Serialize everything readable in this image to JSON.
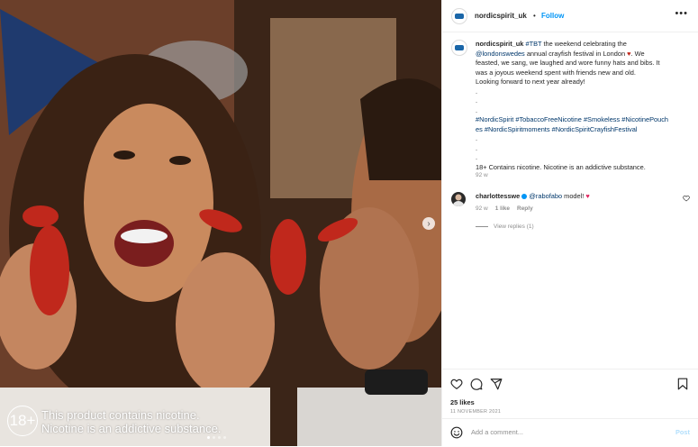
{
  "photo": {
    "overlay_line1": "This product contains nicotine.",
    "overlay_line2": "Nicotine is an addictive substance.",
    "age_badge": "18+",
    "next_icon": "chevron-right-icon",
    "carousel_count": 4,
    "carousel_active": 1
  },
  "header": {
    "username": "nordicspirit_uk",
    "separator": "•",
    "follow_label": "Follow",
    "more_icon": "more-horizontal-icon"
  },
  "caption": {
    "username": "nordicspirit_uk",
    "tbt": "#TBT",
    "line1_after": " the weekend celebrating the",
    "mention": "@londonswedes",
    "line2_after": " annual crayfish festival in London",
    "line3": "feasted, we sang, we laughed and wore funny hats and bibs. It",
    "line4": "was a joyous weekend spent with friends new and old.",
    "line5": "Looking forward to next year already!",
    "line3_prefix": ". We",
    "dot": ".",
    "hashtags_line1": "#NordicSpirit #TobaccoFreeNicotine #Smokeless #NicotinePouch",
    "hashtags_line2": "es #NordicSpiritmoments #NordicSpiritCrayfishFestival",
    "warning": "18+ Contains nicotine. Nicotine is an addictive substance.",
    "time": "92 w"
  },
  "comment": {
    "username": "charlottesswe",
    "mention": "@rabofabo",
    "text": " model!",
    "time": "92 w",
    "likes": "1 like",
    "reply_label": "Reply",
    "view_replies": "View replies (1)"
  },
  "actions": {
    "like_icon": "heart-icon",
    "comment_icon": "comment-icon",
    "share_icon": "send-icon",
    "save_icon": "bookmark-icon",
    "likes_count": "25 likes",
    "date": "11 NOVEMBER 2021"
  },
  "add_comment": {
    "placeholder": "Add a comment...",
    "post_label": "Post",
    "emoji_icon": "smiley-icon"
  },
  "colors": {
    "link": "#0095f6",
    "hashtag": "#00376b",
    "muted": "#8e8e8e",
    "border": "#efefef"
  }
}
